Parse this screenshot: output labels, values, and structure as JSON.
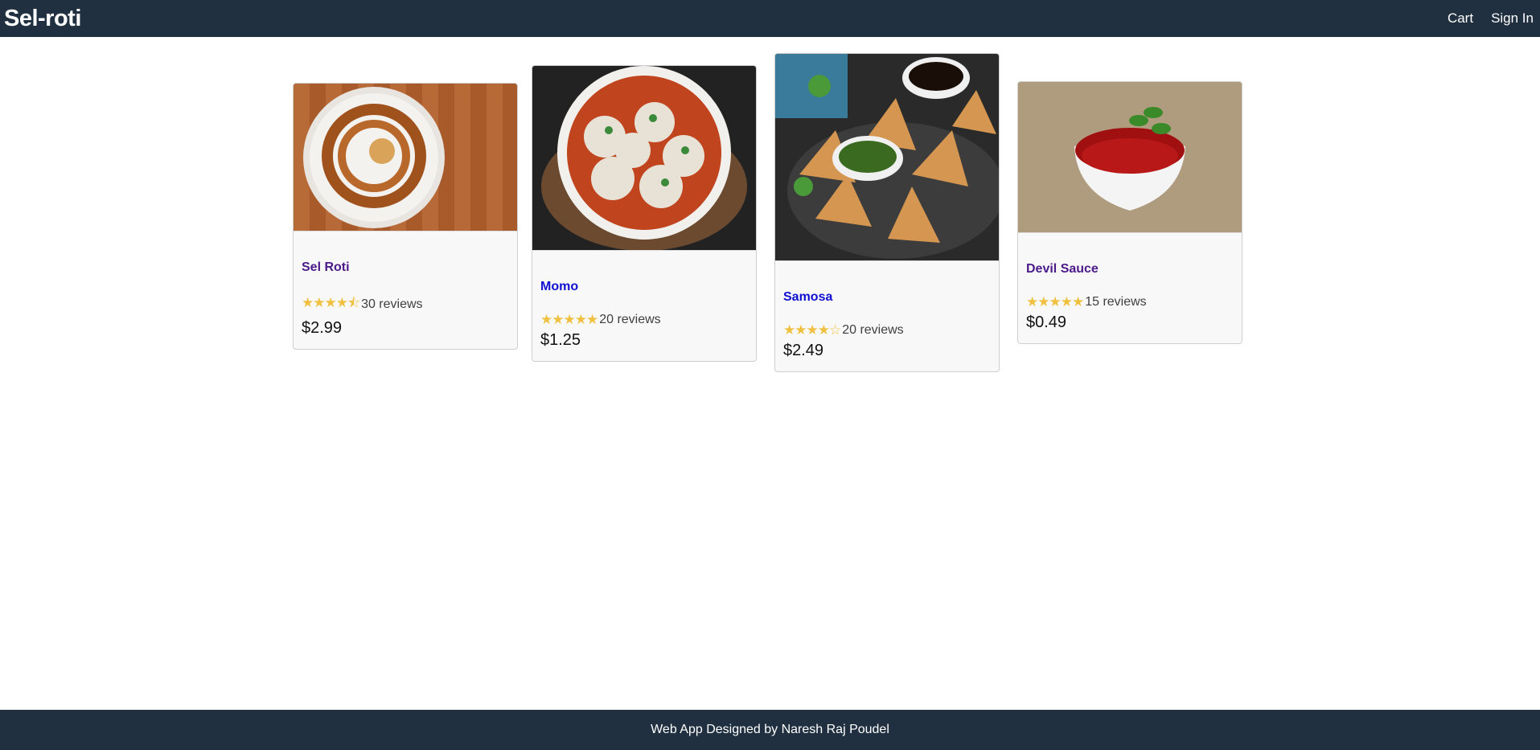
{
  "header": {
    "brand": "Sel-roti",
    "nav": {
      "cart": "Cart",
      "sign_in": "Sign In"
    }
  },
  "products": [
    {
      "name": "Sel Roti",
      "stars": "★★★★⯪",
      "reviews": "30 reviews",
      "price": "$2.99",
      "rating": 4.5,
      "name_color": "#4b1a8a"
    },
    {
      "name": "Momo",
      "stars": "★★★★★",
      "reviews": "20 reviews",
      "price": "$1.25",
      "rating": 5,
      "name_color": "#1010d0"
    },
    {
      "name": "Samosa",
      "stars": "★★★★☆",
      "reviews": "20 reviews",
      "price": "$2.49",
      "rating": 4,
      "name_color": "#1010d0"
    },
    {
      "name": "Devil Sauce",
      "stars": "★★★★★",
      "reviews": "15 reviews",
      "price": "$0.49",
      "rating": 5,
      "name_color": "#4b1a8a"
    }
  ],
  "footer": {
    "text": "Web App Designed by Naresh Raj Poudel"
  },
  "colors": {
    "header_bg": "#203040",
    "star": "#f0c040"
  }
}
